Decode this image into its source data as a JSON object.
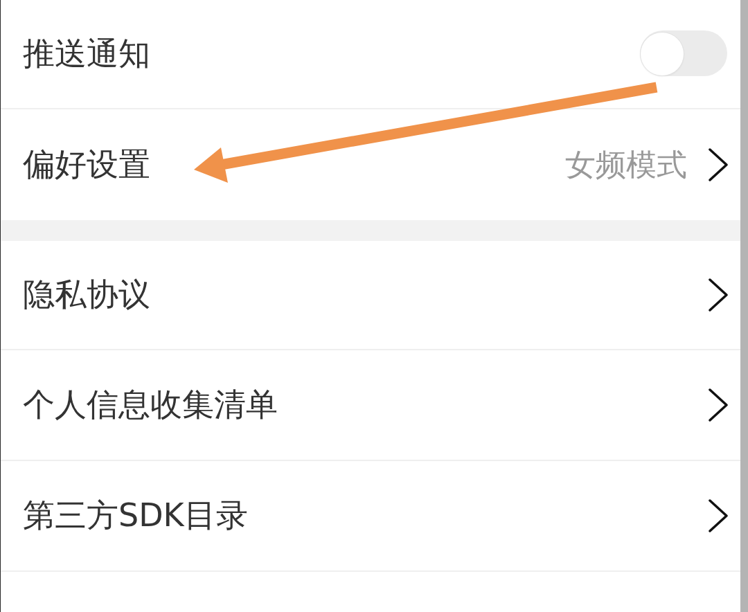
{
  "sections": [
    {
      "items": [
        {
          "kind": "toggle",
          "label": "推送通知",
          "on": false
        },
        {
          "kind": "link",
          "label": "偏好设置",
          "value": "女频模式"
        }
      ]
    },
    {
      "items": [
        {
          "kind": "link",
          "label": "隐私协议"
        },
        {
          "kind": "link",
          "label": "个人信息收集清单"
        },
        {
          "kind": "link",
          "label": "第三方SDK目录"
        }
      ]
    }
  ]
}
